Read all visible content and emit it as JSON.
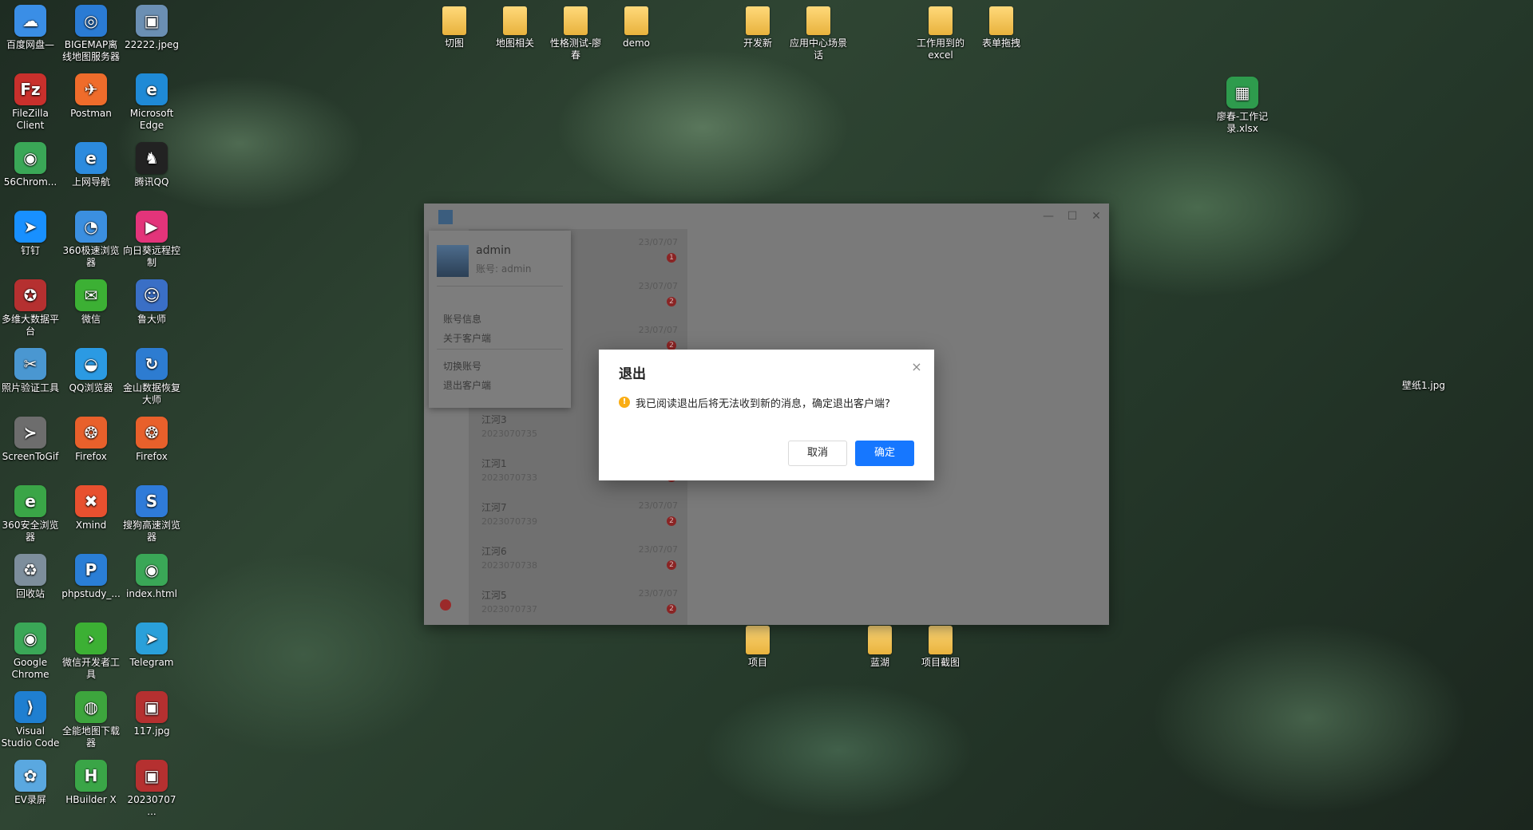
{
  "desktop": {
    "left_icons": [
      {
        "label": "百度网盘—",
        "color": "#3a8ee6",
        "glyph": "☁"
      },
      {
        "label": "BIGEMAP离线地图服务器",
        "color": "#2a7bd4",
        "glyph": "◎"
      },
      {
        "label": "22222.jpeg",
        "color": "#6b8fb3",
        "glyph": "▣"
      },
      {
        "label": "FileZilla Client",
        "color": "#c9302c",
        "glyph": "Fz"
      },
      {
        "label": "Postman",
        "color": "#ef6c2b",
        "glyph": "✈"
      },
      {
        "label": "Microsoft Edge",
        "color": "#1f8ad6",
        "glyph": "e"
      },
      {
        "label": "56Chrom...",
        "color": "#3aa757",
        "glyph": "◉"
      },
      {
        "label": "上网导航",
        "color": "#2c8bde",
        "glyph": "e"
      },
      {
        "label": "腾讯QQ",
        "color": "#222222",
        "glyph": "♞"
      },
      {
        "label": "钉钉",
        "color": "#1890ff",
        "glyph": "➤"
      },
      {
        "label": "360极速浏览器",
        "color": "#3b8fe0",
        "glyph": "◔"
      },
      {
        "label": "向日葵远程控制",
        "color": "#e3347a",
        "glyph": "▶"
      },
      {
        "label": "多维大数据平台",
        "color": "#b53030",
        "glyph": "✪"
      },
      {
        "label": "微信",
        "color": "#3cb034",
        "glyph": "✉"
      },
      {
        "label": "鲁大师",
        "color": "#3a6fc6",
        "glyph": "☺"
      },
      {
        "label": "照片验证工具",
        "color": "#4a97d1",
        "glyph": "✂"
      },
      {
        "label": "QQ浏览器",
        "color": "#2b9ae3",
        "glyph": "◒"
      },
      {
        "label": "金山数据恢复大师",
        "color": "#2d7cd1",
        "glyph": "↻"
      },
      {
        "label": "ScreenToGif",
        "color": "#6d6d6d",
        "glyph": "≻"
      },
      {
        "label": "Firefox",
        "color": "#e8602b",
        "glyph": "❂"
      },
      {
        "label": "Firefox",
        "color": "#e8602b",
        "glyph": "❂"
      },
      {
        "label": "360安全浏览器",
        "color": "#3aa547",
        "glyph": "e"
      },
      {
        "label": "Xmind",
        "color": "#e8502f",
        "glyph": "✖"
      },
      {
        "label": "搜狗高速浏览器",
        "color": "#2f7bd9",
        "glyph": "S"
      },
      {
        "label": "回收站",
        "color": "#7d8e9c",
        "glyph": "♻"
      },
      {
        "label": "phpstudy_...",
        "color": "#2a7ed6",
        "glyph": "P"
      },
      {
        "label": "index.html",
        "color": "#3aa757",
        "glyph": "◉"
      },
      {
        "label": "Google Chrome",
        "color": "#3aa757",
        "glyph": "◉"
      },
      {
        "label": "微信开发者工具",
        "color": "#3cb034",
        "glyph": "›"
      },
      {
        "label": "Telegram",
        "color": "#2aa0da",
        "glyph": "➤"
      },
      {
        "label": "Visual Studio Code",
        "color": "#1f7fd1",
        "glyph": "⟩"
      },
      {
        "label": "全能地图下载器",
        "color": "#3da53d",
        "glyph": "◍"
      },
      {
        "label": "117.jpg",
        "color": "#b53030",
        "glyph": "▣"
      },
      {
        "label": "EV录屏",
        "color": "#5aa8e0",
        "glyph": "✿"
      },
      {
        "label": "HBuilder X",
        "color": "#3aa547",
        "glyph": "H"
      },
      {
        "label": "20230707 ...",
        "color": "#b53030",
        "glyph": "▣"
      }
    ],
    "top_folders": [
      "切图",
      "地图相关",
      "性格测试-廖春",
      "demo",
      "开发新",
      "应用中心场景话",
      "工作用到的excel",
      "表单拖拽"
    ],
    "right_items": [
      "廖春-工作记录.xlsx",
      "壁纸1.jpg"
    ],
    "bottom_folders": [
      "项目",
      "蓝湖",
      "项目截图"
    ]
  },
  "app": {
    "window_controls": [
      "—",
      "☐",
      "✕"
    ],
    "conversations": [
      {
        "name": "",
        "sub": "",
        "date": "23/07/07",
        "badge": "1"
      },
      {
        "name": "",
        "sub": "",
        "date": "23/07/07",
        "badge": "2"
      },
      {
        "name": "",
        "sub": "",
        "date": "23/07/07",
        "badge": "2"
      },
      {
        "name": "",
        "sub": "",
        "date": "",
        "badge": ""
      },
      {
        "name": "江河3",
        "sub": "2023070735",
        "date": "",
        "badge": ""
      },
      {
        "name": "江河1",
        "sub": "2023070733",
        "date": "",
        "badge": "2"
      },
      {
        "name": "江河7",
        "sub": "2023070739",
        "date": "23/07/07",
        "badge": "2"
      },
      {
        "name": "江河6",
        "sub": "2023070738",
        "date": "23/07/07",
        "badge": "2"
      },
      {
        "name": "江河5",
        "sub": "2023070737",
        "date": "23/07/07",
        "badge": "2"
      }
    ]
  },
  "user_menu": {
    "name": "admin",
    "account": "账号: admin",
    "items": [
      "账号信息",
      "关于客户端",
      "切换账号",
      "退出客户端"
    ]
  },
  "dialog": {
    "title": "退出",
    "message": "我已阅读退出后将无法收到新的消息，确定退出客户端?",
    "cancel": "取消",
    "confirm": "确定",
    "close_icon": "×",
    "warn_icon": "!"
  },
  "colors": {
    "primary": "#1677ff",
    "warning": "#faad14"
  }
}
